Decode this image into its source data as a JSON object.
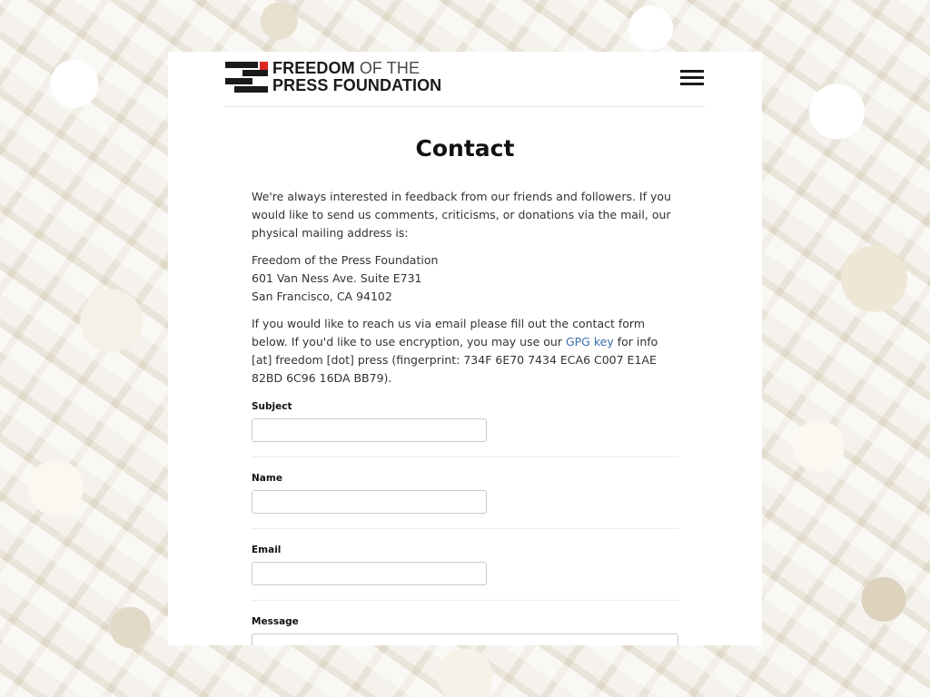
{
  "header": {
    "logo_line1_bold": "FREEDOM",
    "logo_line1_light": "OF THE",
    "logo_line2": "PRESS FOUNDATION",
    "menu_icon": "hamburger-menu-icon",
    "accent_color": "#e02424"
  },
  "page": {
    "title": "Contact"
  },
  "intro": {
    "paragraph1": "We're always interested in feedback from our friends and followers. If you would like to send us comments, criticisms, or donations via the mail, our physical mailing address is:",
    "address_line1": "Freedom of the Press Foundation",
    "address_line2": "601 Van Ness Ave. Suite E731",
    "address_line3": "San Francisco, CA 94102",
    "paragraph3_before_link": "If you would like to reach us via email please fill out the contact form below. If you'd like to use encryption, you may use our ",
    "gpg_link": "GPG key",
    "paragraph3_after_link": " for info [at] freedom [dot] press (fingerprint: 734F 6E70 7434 ECA6 C007 E1AE 82BD 6C96 16DA BB79).",
    "link_color": "#3b6fb0"
  },
  "form": {
    "subject_label": "Subject",
    "subject_value": "",
    "name_label": "Name",
    "name_value": "",
    "email_label": "Email",
    "email_value": "",
    "message_label": "Message",
    "message_value": ""
  }
}
